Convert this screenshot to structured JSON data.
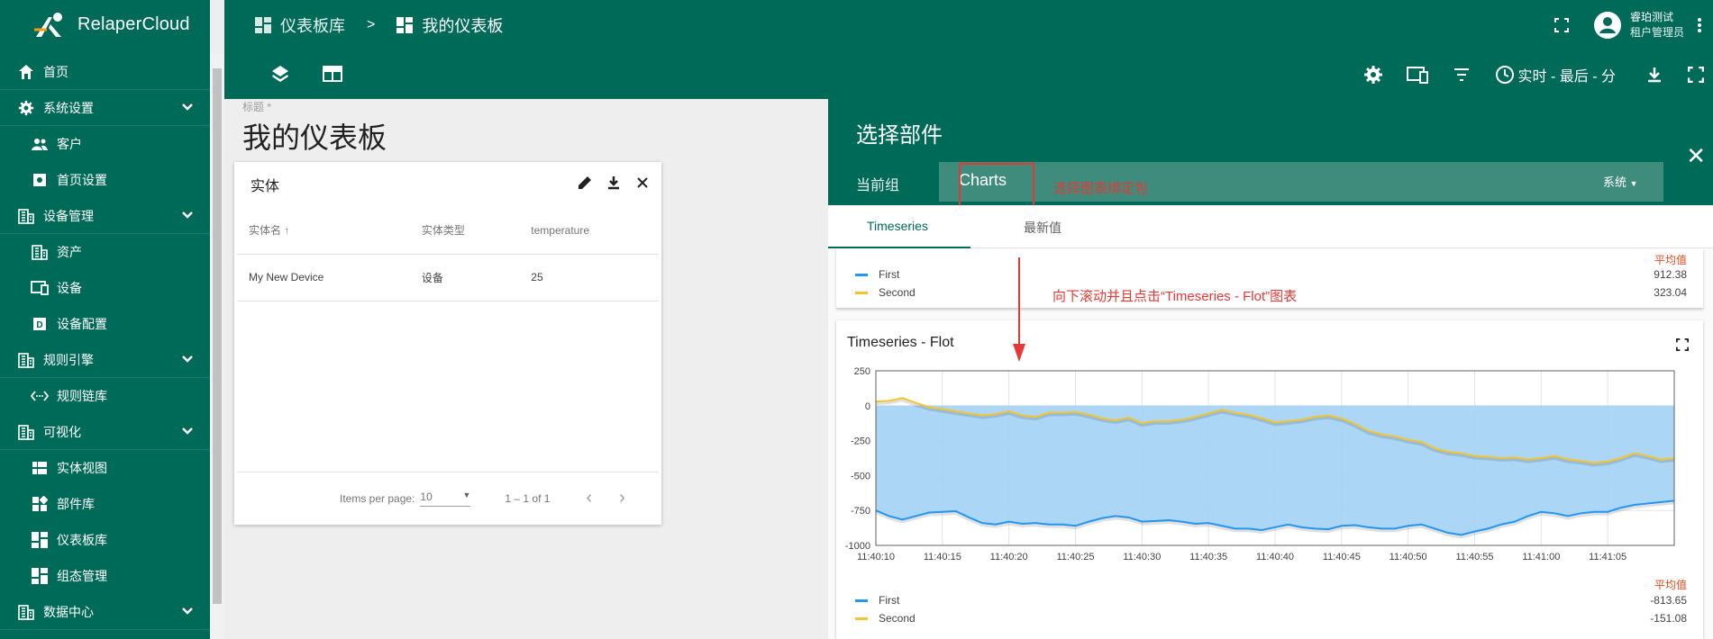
{
  "app": {
    "brand": "RelaperCloud"
  },
  "breadcrumb": {
    "item1": "仪表板库",
    "separator": ">",
    "item2": "我的仪表板"
  },
  "user": {
    "name": "睿珀测试",
    "role": "租户管理员"
  },
  "toolbar": {
    "timewindow": "实时 - 最后 - 分"
  },
  "sidebar": {
    "items": [
      {
        "label": "首页",
        "icon": "home-icon",
        "level": "top"
      },
      {
        "label": "系统设置",
        "icon": "gear-icon",
        "level": "top",
        "expandable": true
      },
      {
        "label": "客户",
        "icon": "users-icon",
        "level": "sub"
      },
      {
        "label": "首页设置",
        "icon": "settings-box-icon",
        "level": "sub"
      },
      {
        "label": "设备管理",
        "icon": "building-icon",
        "level": "top",
        "expandable": true
      },
      {
        "label": "资产",
        "icon": "building-icon",
        "level": "sub"
      },
      {
        "label": "设备",
        "icon": "devices-icon",
        "level": "sub"
      },
      {
        "label": "设备配置",
        "icon": "device-profile-icon",
        "level": "sub"
      },
      {
        "label": "规则引擎",
        "icon": "building-icon",
        "level": "top",
        "expandable": true
      },
      {
        "label": "规则链库",
        "icon": "rule-chain-icon",
        "level": "sub"
      },
      {
        "label": "可视化",
        "icon": "building-icon",
        "level": "top",
        "expandable": true
      },
      {
        "label": "实体视图",
        "icon": "entity-view-icon",
        "level": "sub"
      },
      {
        "label": "部件库",
        "icon": "widgets-icon",
        "level": "sub"
      },
      {
        "label": "仪表板库",
        "icon": "dashboard-icon",
        "level": "sub"
      },
      {
        "label": "组态管理",
        "icon": "dashboard-icon",
        "level": "sub"
      },
      {
        "label": "数据中心",
        "icon": "building-icon",
        "level": "top",
        "expandable": true
      }
    ]
  },
  "dashboard": {
    "title_label": "标题 *",
    "title": "我的仪表板"
  },
  "entity_widget": {
    "title": "实体",
    "columns": [
      "实体名 ↑",
      "实体类型",
      "temperature"
    ],
    "rows": [
      [
        "My New Device",
        "设备",
        "25"
      ]
    ],
    "items_per_page_label": "Items per page:",
    "items_per_page": "10",
    "range": "1 – 1 of 1"
  },
  "panel": {
    "title": "选择部件",
    "tab_current": "当前组",
    "tab_charts": "Charts",
    "annotation_select": "选择图表绑定包",
    "system_dropdown": "系统",
    "subtabs": [
      "Timeseries",
      "最新值"
    ],
    "annotation_scroll": "向下滚动并且点击“Timeseries - Flot”图表",
    "top_legend": {
      "avg_label": "平均值",
      "rows": [
        {
          "name": "First",
          "value": "912.38"
        },
        {
          "name": "Second",
          "value": "323.04"
        }
      ]
    },
    "chart_card": {
      "title": "Timeseries - Flot",
      "avg_label": "平均值",
      "legend": [
        {
          "name": "First",
          "value": "-813.65"
        },
        {
          "name": "Second",
          "value": "-151.08"
        }
      ]
    }
  },
  "colors": {
    "primary": "#006a58",
    "first_series": "#2196f3",
    "second_series": "#f4c430",
    "fill": "#a3d2f5",
    "annotation": "#e53935"
  },
  "chart_data": {
    "type": "line",
    "title": "Timeseries - Flot",
    "x_ticks": [
      "11:40:10",
      "11:40:15",
      "11:40:20",
      "11:40:25",
      "11:40:30",
      "11:40:35",
      "11:40:40",
      "11:40:45",
      "11:40:50",
      "11:40:55",
      "11:41:00",
      "11:41:05"
    ],
    "y_ticks": [
      250,
      0,
      -250,
      -500,
      -750,
      -1000
    ],
    "ylim": [
      -1000,
      250
    ],
    "xlim_seconds": [
      10,
      70
    ],
    "series": [
      {
        "name": "First",
        "color": "#2196f3",
        "x": [
          10,
          11,
          12,
          13,
          14,
          15,
          16,
          17,
          18,
          19,
          20,
          21,
          22,
          23,
          24,
          25,
          26,
          27,
          28,
          29,
          30,
          31,
          32,
          33,
          34,
          35,
          36,
          37,
          38,
          39,
          40,
          41,
          42,
          43,
          44,
          45,
          46,
          47,
          48,
          49,
          50,
          51,
          52,
          53,
          54,
          55,
          56,
          57,
          58,
          59,
          60,
          61,
          62,
          63,
          64,
          65,
          66,
          67,
          68,
          69,
          70
        ],
        "values": [
          -750,
          -790,
          -815,
          -790,
          -765,
          -760,
          -755,
          -800,
          -840,
          -850,
          -830,
          -845,
          -840,
          -850,
          -850,
          -860,
          -830,
          -805,
          -790,
          -800,
          -830,
          -825,
          -820,
          -830,
          -845,
          -840,
          -860,
          -880,
          -880,
          -890,
          -870,
          -850,
          -870,
          -880,
          -885,
          -860,
          -855,
          -870,
          -880,
          -880,
          -860,
          -850,
          -880,
          -910,
          -925,
          -900,
          -880,
          -850,
          -830,
          -790,
          -760,
          -770,
          -790,
          -770,
          -760,
          -760,
          -730,
          -710,
          -700,
          -690,
          -680
        ]
      },
      {
        "name": "Second",
        "color": "#f4c430",
        "x": [
          10,
          11,
          12,
          13,
          14,
          15,
          16,
          17,
          18,
          19,
          20,
          21,
          22,
          23,
          24,
          25,
          26,
          27,
          28,
          29,
          30,
          31,
          32,
          33,
          34,
          35,
          36,
          37,
          38,
          39,
          40,
          41,
          42,
          43,
          44,
          45,
          46,
          47,
          48,
          49,
          50,
          51,
          52,
          53,
          54,
          55,
          56,
          57,
          58,
          59,
          60,
          61,
          62,
          63,
          64,
          65,
          66,
          67,
          68,
          69,
          70
        ],
        "values": [
          30,
          35,
          55,
          20,
          -10,
          -25,
          -40,
          -55,
          -70,
          -60,
          -40,
          -70,
          -80,
          -50,
          -50,
          -45,
          -65,
          -90,
          -105,
          -85,
          -125,
          -110,
          -110,
          -100,
          -80,
          -55,
          -30,
          -50,
          -65,
          -90,
          -120,
          -110,
          -100,
          -80,
          -70,
          -90,
          -130,
          -180,
          -205,
          -220,
          -245,
          -260,
          -305,
          -330,
          -340,
          -360,
          -365,
          -375,
          -370,
          -385,
          -375,
          -360,
          -385,
          -395,
          -410,
          -400,
          -375,
          -340,
          -360,
          -385,
          -375
        ]
      }
    ]
  }
}
